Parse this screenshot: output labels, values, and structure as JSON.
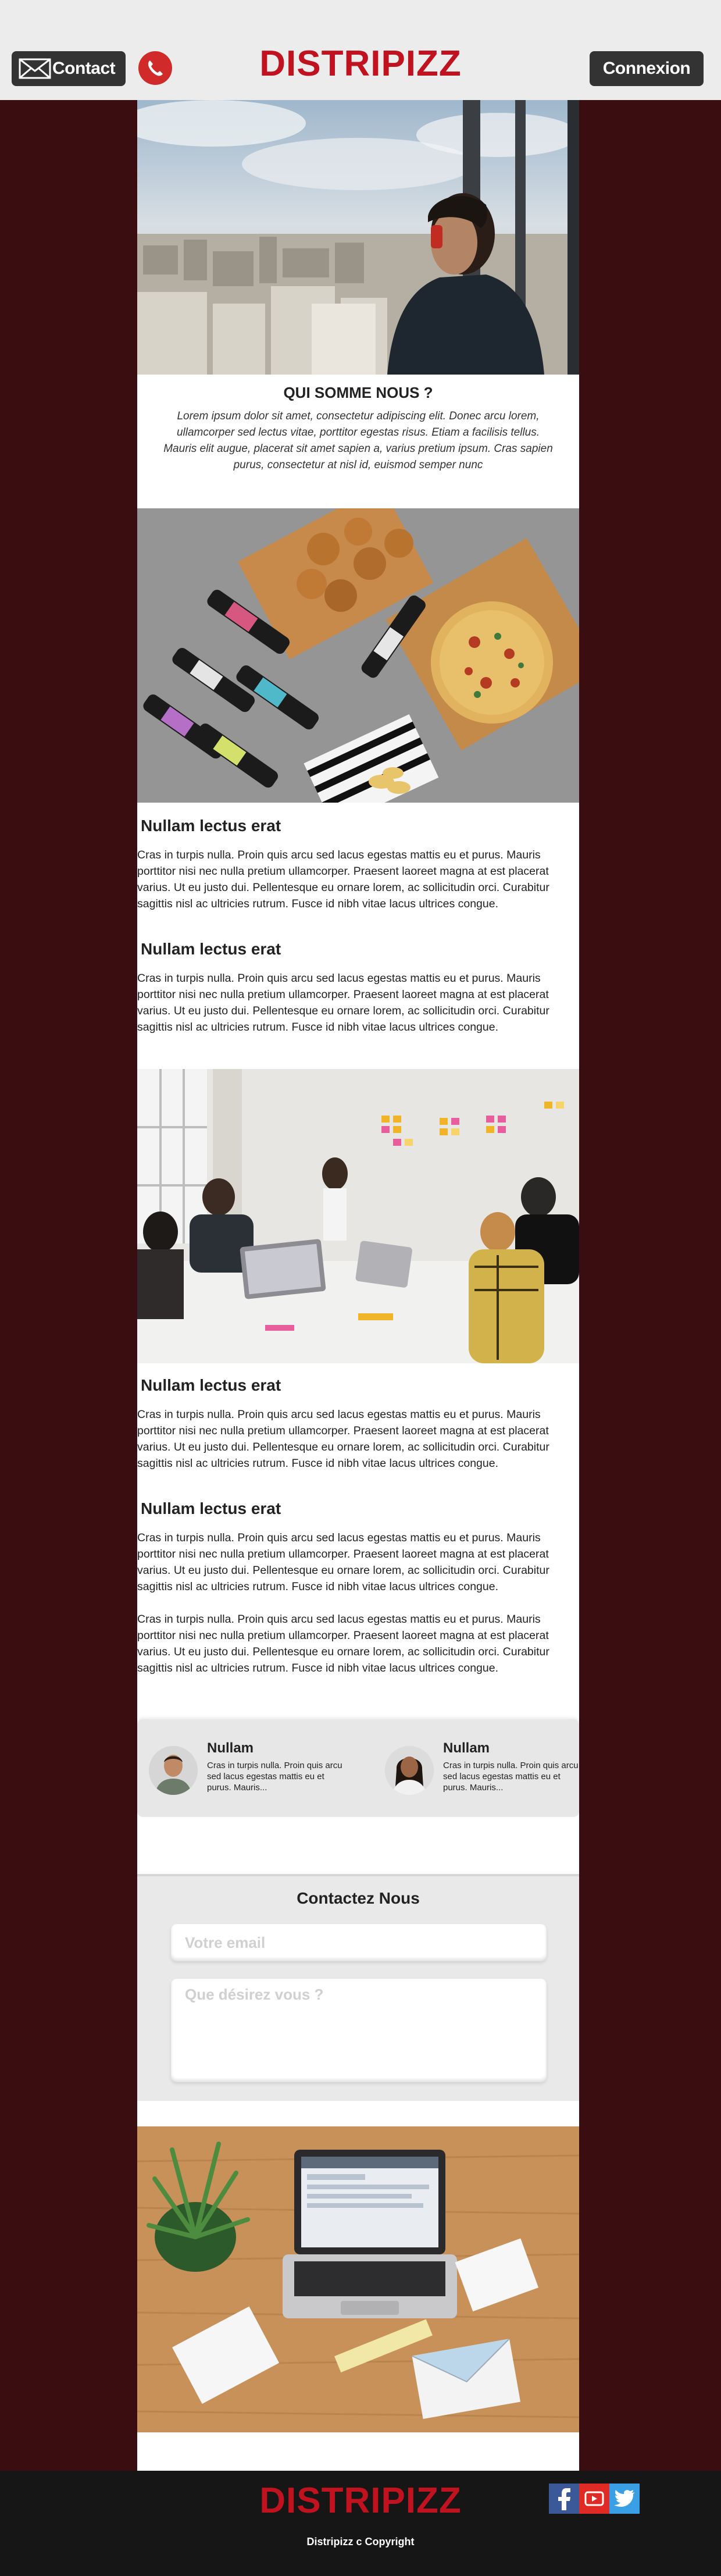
{
  "header": {
    "contact_label": "Contact",
    "brand": "DISTRIPIZZ",
    "login_label": "Connexion",
    "icons": [
      "mail-icon",
      "phone-icon"
    ]
  },
  "about": {
    "title": "QUI SOMME NOUS ?",
    "text": "Lorem ipsum dolor sit amet, consectetur adipiscing elit. Donec arcu lorem, ullamcorper sed lectus vitae, porttitor egestas risus. Etiam a facilisis tellus. Mauris elit augue, placerat sit amet sapien a, varius pretium ipsum. Cras sapien purus, consectetur at nisl id, euismod semper nunc"
  },
  "sections": [
    {
      "title": "Nullam lectus erat",
      "text": "Cras in turpis nulla. Proin quis arcu sed lacus egestas mattis eu et purus. Mauris porttitor nisi nec nulla pretium ullamcorper. Praesent laoreet magna at est placerat varius. Ut eu justo dui. Pellentesque eu ornare lorem, ac sollicitudin orci. Curabitur sagittis nisl ac ultricies rutrum. Fusce id nibh vitae lacus ultrices congue."
    },
    {
      "title": "Nullam lectus erat",
      "text": "Cras in turpis nulla. Proin quis arcu sed lacus egestas mattis eu et purus. Mauris porttitor nisi nec nulla pretium ullamcorper. Praesent laoreet magna at est placerat varius. Ut eu justo dui. Pellentesque eu ornare lorem, ac sollicitudin orci. Curabitur sagittis nisl ac ultricies rutrum. Fusce id nibh vitae lacus ultrices congue."
    },
    {
      "title": "Nullam lectus erat",
      "text": "Cras in turpis nulla. Proin quis arcu sed lacus egestas mattis eu et purus. Mauris porttitor nisi nec nulla pretium ullamcorper. Praesent laoreet magna at est placerat varius. Ut eu justo dui. Pellentesque eu ornare lorem, ac sollicitudin orci. Curabitur sagittis nisl ac ultricies rutrum. Fusce id nibh vitae lacus ultrices congue."
    },
    {
      "title": "Nullam lectus erat",
      "text": "Cras in turpis nulla. Proin quis arcu sed lacus egestas mattis eu et purus. Mauris porttitor nisi nec nulla pretium ullamcorper. Praesent laoreet magna at est placerat varius. Ut eu justo dui. Pellentesque eu ornare lorem, ac sollicitudin orci. Curabitur sagittis nisl ac ultricies rutrum. Fusce id nibh vitae lacus ultrices congue.",
      "text2": "Cras in turpis nulla. Proin quis arcu sed lacus egestas mattis eu et purus. Mauris porttitor nisi nec nulla pretium ullamcorper. Praesent laoreet magna at est placerat varius. Ut eu justo dui. Pellentesque eu ornare lorem, ac sollicitudin orci. Curabitur sagittis nisl ac ultricies rutrum. Fusce id nibh vitae lacus ultrices congue."
    }
  ],
  "testimonials": [
    {
      "name": "Nullam",
      "text": "Cras in turpis nulla. Proin quis arcu sed lacus egestas mattis eu et purus. Mauris..."
    },
    {
      "name": "Nullam",
      "text": "Cras in turpis nulla. Proin quis arcu sed lacus egestas mattis eu et purus. Mauris..."
    }
  ],
  "contact_form": {
    "title": "Contactez Nous",
    "email_placeholder": "Votre email",
    "message_placeholder": "Que désirez vous ?"
  },
  "footer": {
    "brand": "DISTRIPIZZ",
    "copyright": "Distripizz c Copyright",
    "social_icons": [
      "facebook-icon",
      "youtube-icon",
      "twitter-icon"
    ]
  },
  "colors": {
    "brand_red": "#c1121f",
    "page_bg": "#3a0e10",
    "header_bg": "#ececec",
    "footer_bg": "#161616"
  }
}
